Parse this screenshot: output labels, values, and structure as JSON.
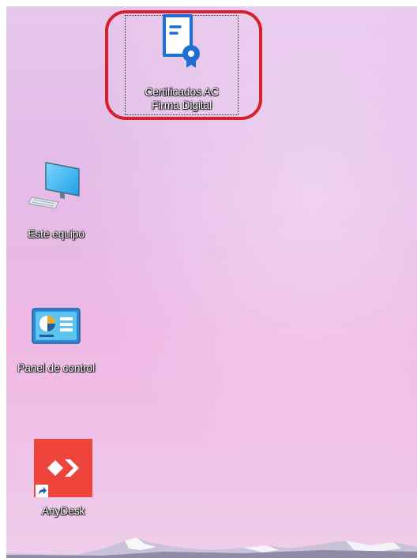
{
  "desktop": {
    "icons": [
      {
        "label_line1": "Certificados AC",
        "label_line2": "Firma Digital",
        "icon": "certificate-icon",
        "selected": true
      },
      {
        "label": "Este equipo",
        "icon": "computer-icon"
      },
      {
        "label": "Panel de control",
        "icon": "control-panel-icon"
      },
      {
        "label": "AnyDesk",
        "icon": "anydesk-icon",
        "shortcut": true
      }
    ]
  },
  "colors": {
    "highlight": "#d6202a",
    "anydesk": "#ef443b",
    "certificate": "#1f6fd1"
  }
}
